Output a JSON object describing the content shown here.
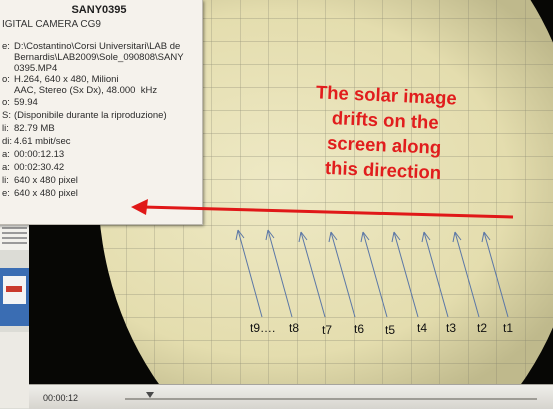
{
  "info_panel": {
    "title": "SANY0395",
    "subtitle": "IGITAL CAMERA CG9",
    "rows": [
      {
        "key": "e:",
        "value": "D:\\Costantino\\Corsi Universitari\\LAB de\nBernardis\\LAB2009\\Sole_090808\\SANY\n0395.MP4"
      },
      {
        "key": "o:",
        "value": "H.264, 640 x 480, Milioni\nAAC, Stereo (Sx Dx), 48.000  kHz"
      },
      {
        "key": "o:",
        "value": "59.94"
      },
      {
        "key": "S:",
        "value": "(Disponibile durante la riproduzione)"
      },
      {
        "key": "li:",
        "value": "82.79 MB"
      },
      {
        "key": "di:",
        "value": "4.61 mbit/sec"
      },
      {
        "key": "a:",
        "value": "00:00:12.13"
      },
      {
        "key": "a:",
        "value": "00:02:30.42"
      },
      {
        "key": "li:",
        "value": "640 x 480 pixel"
      },
      {
        "key": "e:",
        "value": "640 x 480 pixel"
      }
    ]
  },
  "overlay": {
    "text": "The solar image\ndrifts on the\nscreen along\nthis direction",
    "color": "#e11d1d"
  },
  "time_labels": [
    "t9….",
    "t8",
    "t7",
    "t6",
    "t5",
    "t4",
    "t3",
    "t2",
    "t1"
  ],
  "controls": {
    "current_time": "00:00:12",
    "seek_position": 0.06
  },
  "colors": {
    "grid_background": "#e9e3ba",
    "dark_vignette": "#070705",
    "arrow_red": "#e01818",
    "annotation_lines": "#5b77a6"
  }
}
